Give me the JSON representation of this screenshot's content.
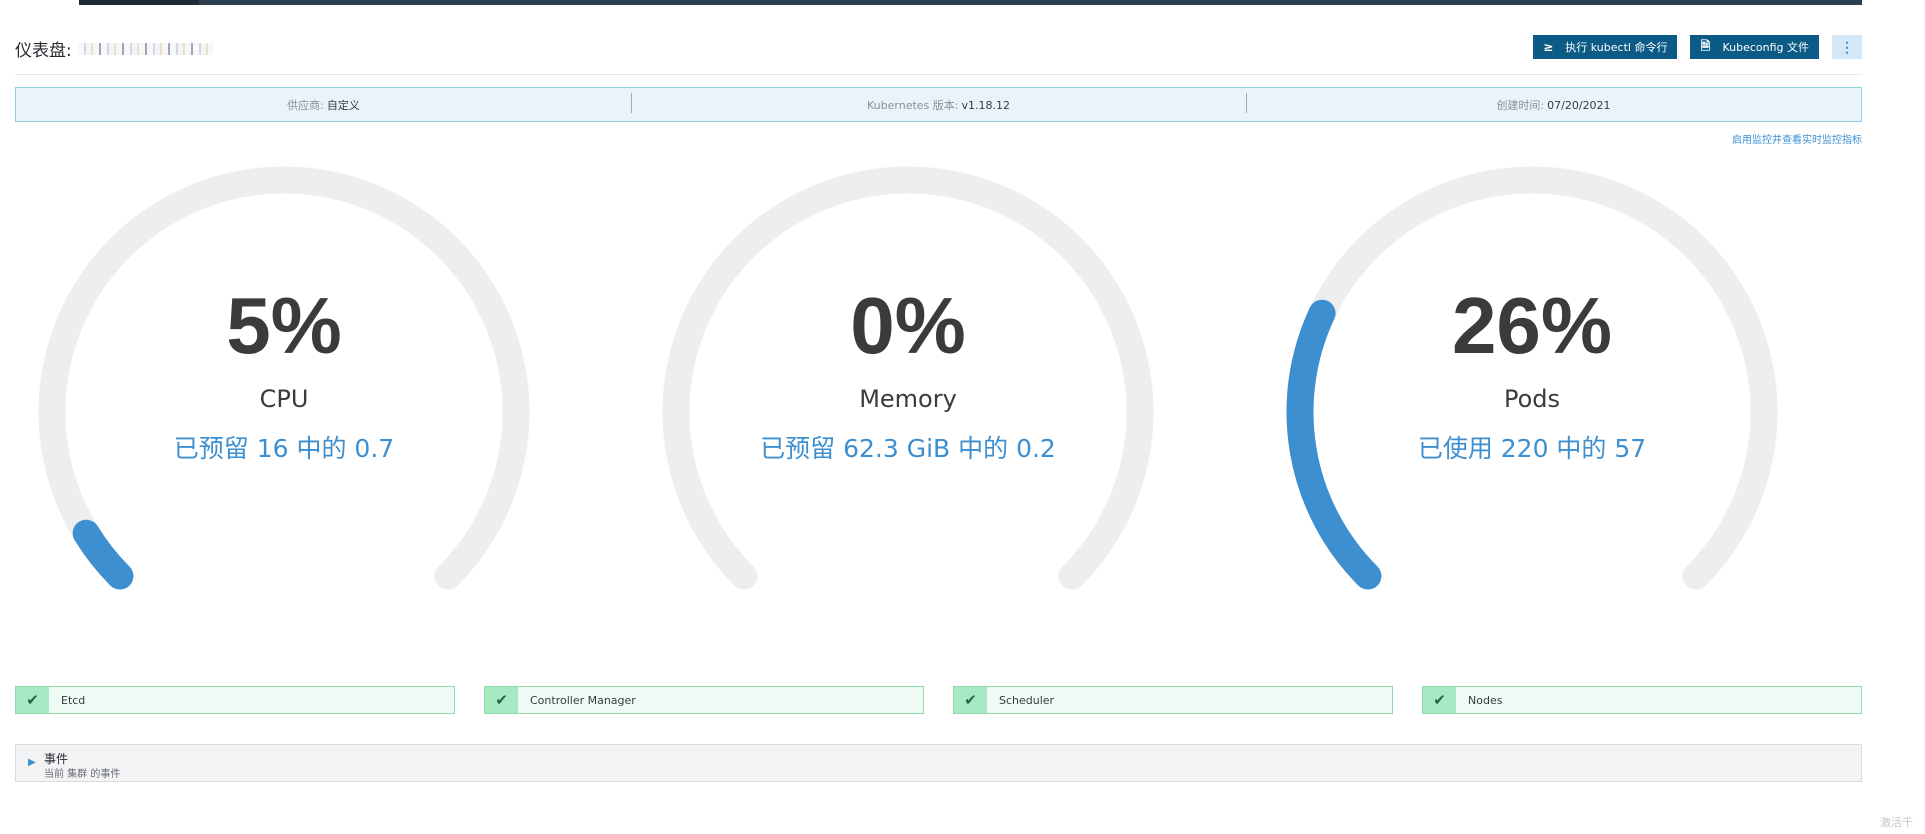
{
  "header": {
    "title": "仪表盘:",
    "kubectl_button": "执行 kubectl 命令行",
    "kubeconfig_button": "Kubeconfig 文件",
    "more_button": "⋮"
  },
  "info": {
    "provider_label": "供应商:",
    "provider_value": "自定义",
    "version_label": "Kubernetes 版本:",
    "version_value": "v1.18.12",
    "created_label": "创建时间:",
    "created_value": "07/20/2021"
  },
  "monitor_link": "启用监控并查看实时监控指标",
  "gauges": [
    {
      "percent_text": "5%",
      "fraction": 0.05,
      "label": "CPU",
      "detail": "已预留 16 中的 0.7"
    },
    {
      "percent_text": "0%",
      "fraction": 0.0,
      "label": "Memory",
      "detail": "已预留 62.3 GiB 中的 0.2"
    },
    {
      "percent_text": "26%",
      "fraction": 0.26,
      "label": "Pods",
      "detail": "已使用 220 中的 57"
    }
  ],
  "status": [
    {
      "label": "Etcd"
    },
    {
      "label": "Controller Manager"
    },
    {
      "label": "Scheduler"
    },
    {
      "label": "Nodes"
    }
  ],
  "events": {
    "title": "事件",
    "subtitle": "当前 集群 的事件"
  },
  "watermark": "激活千",
  "colors": {
    "accent": "#3d8fd0",
    "track": "#eceeef",
    "button": "#0b5b86",
    "ok": "#a6e9c3"
  }
}
